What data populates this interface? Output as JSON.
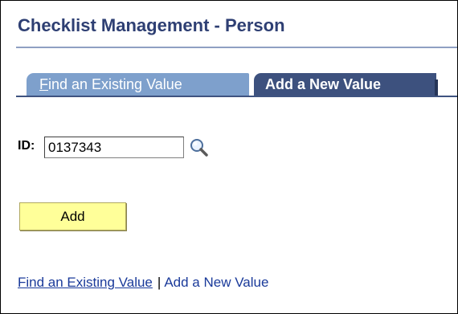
{
  "page": {
    "title": "Checklist Management - Person"
  },
  "tabs": {
    "find_existing": {
      "access_key": "F",
      "rest": "ind an Existing Value"
    },
    "add_new": {
      "label": "Add a New Value",
      "active": true
    }
  },
  "form": {
    "id_label": "ID:",
    "id_value": "0137343",
    "lookup_icon": "magnifier-lookup-icon",
    "add_button_label": "Add"
  },
  "footer_links": {
    "find_existing": "Find an Existing Value",
    "separator": "|",
    "add_new": "Add a New Value"
  },
  "colors": {
    "title": "#2e3f73",
    "active_tab": "#3d517e",
    "inactive_tab": "#7ea0cc",
    "button_fill": "#ffff99",
    "link": "#1a3a9a"
  }
}
